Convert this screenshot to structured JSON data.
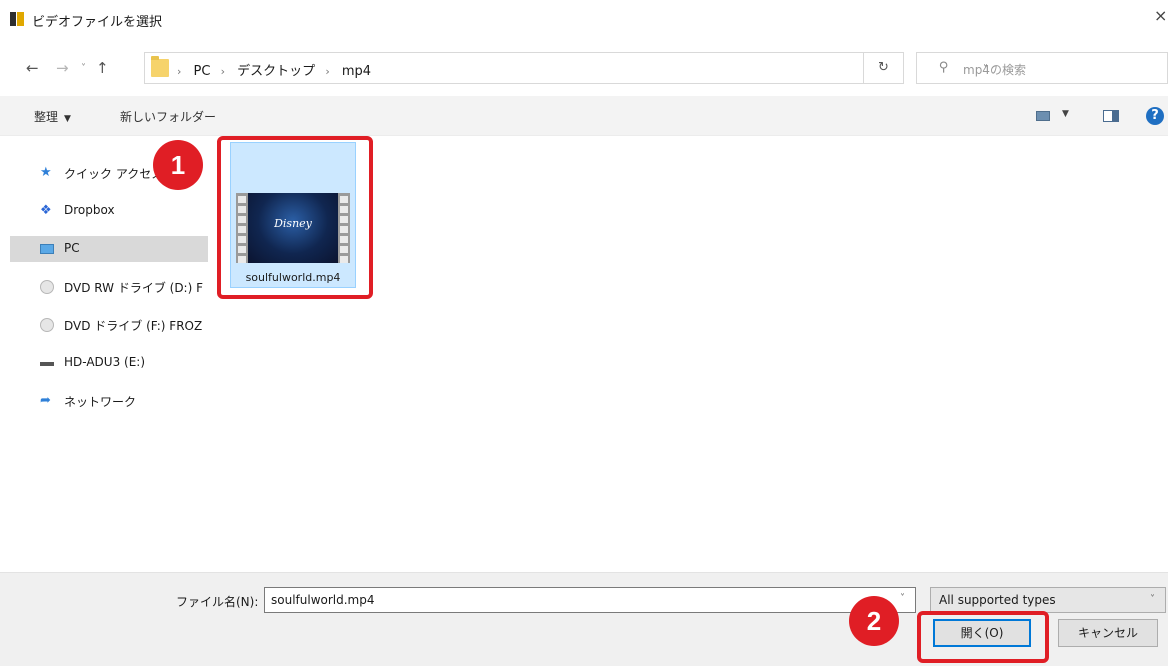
{
  "window": {
    "title": "ビデオファイルを選択",
    "close_glyph": "×"
  },
  "address": {
    "back_glyph": "←",
    "forward_glyph": "→",
    "recent_glyph": "˅",
    "up_glyph": "↑",
    "crumbs": [
      "PC",
      "デスクトップ",
      "mp4"
    ],
    "crumb_sep": "›",
    "dropdown_glyph": "˅",
    "refresh_glyph": "↻",
    "search_icon": "search-icon",
    "search_glyph": "⚲",
    "search_placeholder": "mp4の検索"
  },
  "toolbar": {
    "organize_label": "整理",
    "organize_dd": "▼",
    "new_folder_label": "新しいフォルダー",
    "view_dd": "▼",
    "help_glyph": "?"
  },
  "nav": {
    "items": [
      {
        "label": "クイック アクセス",
        "icon": "star-icon",
        "glyph": "★"
      },
      {
        "label": "Dropbox",
        "icon": "dropbox-icon",
        "glyph": "❖"
      },
      {
        "label": "PC",
        "icon": "pc-icon",
        "glyph": ""
      },
      {
        "label": "DVD RW ドライブ (D:) F",
        "icon": "disc-icon",
        "glyph": ""
      },
      {
        "label": "DVD ドライブ (F:) FROZ",
        "icon": "disc-icon",
        "glyph": ""
      },
      {
        "label": "HD-ADU3 (E:)",
        "icon": "drive-icon",
        "glyph": ""
      },
      {
        "label": "ネットワーク",
        "icon": "network-icon",
        "glyph": "➦"
      }
    ],
    "selected": "PC"
  },
  "files": [
    {
      "name": "soulfulworld.mp4",
      "thumb_logo": "Disney",
      "selected": true
    }
  ],
  "bottom": {
    "filename_label": "ファイル名(N):",
    "filename_value": "soulfulworld.mp4",
    "filename_dd": "˅",
    "filetype_value": "All supported types",
    "filetype_dd": "˅",
    "open_label": "開く(O)",
    "cancel_label": "キャンセル"
  },
  "annotations": {
    "step1": "1",
    "step2": "2",
    "highlight_color": "#e01e25"
  }
}
